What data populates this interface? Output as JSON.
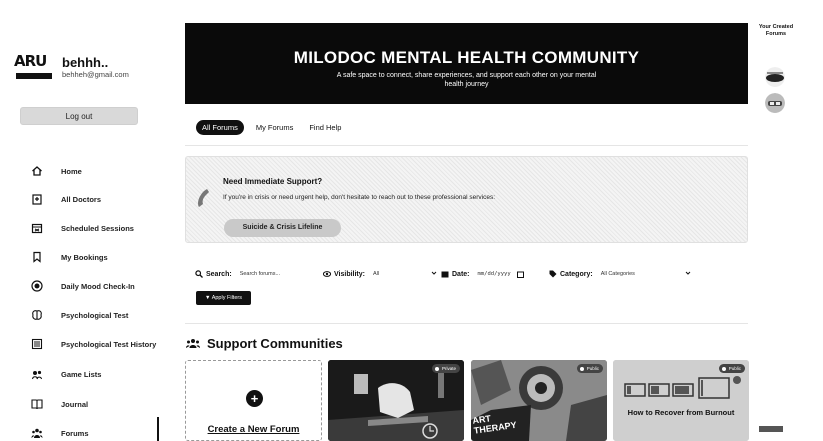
{
  "user": {
    "logo_text": "ARU",
    "name": "behhh..",
    "email": "behheh@gmail.com"
  },
  "sidebar": {
    "logout_label": "Log out",
    "items": [
      {
        "label": "Home",
        "icon": "home-icon"
      },
      {
        "label": "All Doctors",
        "icon": "doctor-icon"
      },
      {
        "label": "Scheduled Sessions",
        "icon": "calendar-icon"
      },
      {
        "label": "My Bookings",
        "icon": "bookmark-icon"
      },
      {
        "label": "Daily Mood Check-In",
        "icon": "mood-icon"
      },
      {
        "label": "Psychological Test",
        "icon": "brain-icon"
      },
      {
        "label": "Psychological Test History",
        "icon": "history-icon"
      },
      {
        "label": "Game Lists",
        "icon": "game-icon"
      },
      {
        "label": "Journal",
        "icon": "journal-icon"
      },
      {
        "label": "Forums",
        "icon": "forums-icon"
      }
    ]
  },
  "banner": {
    "title": "MILODOC MENTAL HEALTH COMMUNITY",
    "subtitle": "A safe space to connect, share experiences, and support each other on your mental health journey"
  },
  "tabs": [
    "All Forums",
    "My Forums",
    "Find Help"
  ],
  "support": {
    "title": "Need Immediate Support?",
    "text": "If you're in crisis or need urgent help, don't hesitate to reach out to these professional services:",
    "button": "Suicide & Crisis Lifeline"
  },
  "filters": {
    "search_label": "Search:",
    "search_placeholder": "Search forums...",
    "visibility_label": "Visibility:",
    "visibility_value": "All",
    "date_label": "Date:",
    "date_placeholder": "mm/dd/yyyy",
    "category_label": "Category:",
    "category_value": "All Categories",
    "apply_label": "Apply Filters"
  },
  "communities": {
    "title": "Support Communities",
    "create_label": "Create a New Forum",
    "cards": [
      {
        "badge": "Private",
        "art_text": ""
      },
      {
        "badge": "Public",
        "art_text": "ART THERAPY"
      },
      {
        "badge": "Public",
        "art_text": "How to Recover from Burnout"
      }
    ]
  },
  "right_panel": {
    "title": "Your Created Forums"
  },
  "colors": {
    "banner_bg": "#0a0a0a",
    "accent": "#111111"
  }
}
